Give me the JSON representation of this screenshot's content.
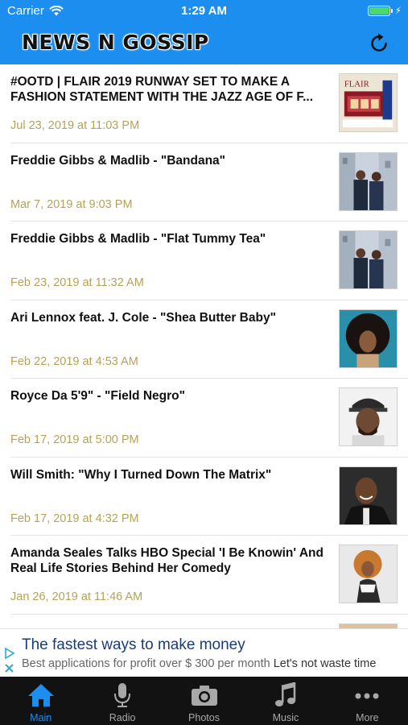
{
  "status_bar": {
    "carrier": "Carrier",
    "time": "1:29 AM",
    "battery_level": 1.0
  },
  "header": {
    "title": "NEWS N GOSSIP",
    "refresh_icon": "refresh-icon"
  },
  "articles": [
    {
      "title": "#OOTD | FLAIR 2019 RUNWAY SET TO MAKE A FASHION STATEMENT WITH THE JAZZ AGE OF F...",
      "date": "Jul 23, 2019 at 11:03 PM",
      "thumb_text": "FLAIR"
    },
    {
      "title": "Freddie Gibbs & Madlib - \"Bandana\"",
      "date": "Mar 7, 2019 at 9:03 PM"
    },
    {
      "title": "Freddie Gibbs & Madlib - \"Flat Tummy Tea\"",
      "date": "Feb 23, 2019 at 11:32 AM"
    },
    {
      "title": "Ari Lennox feat. J. Cole - \"Shea Butter Baby\"",
      "date": "Feb 22, 2019 at 4:53 AM"
    },
    {
      "title": "Royce Da 5'9\" - \"Field Negro\"",
      "date": "Feb 17, 2019 at 5:00 PM"
    },
    {
      "title": "Will Smith: \"Why I Turned Down The Matrix\"",
      "date": "Feb 17, 2019 at 4:32 PM"
    },
    {
      "title": "Amanda Seales Talks HBO Special 'I Be Knowin' And Real Life Stories Behind Her Comedy",
      "date": "Jan 26, 2019 at 11:46 AM"
    }
  ],
  "ad": {
    "headline": "The fastest ways to make money",
    "body": "Best applications for profit over $ 300 per month",
    "body_suffix": "Let's not waste time"
  },
  "tabs": [
    {
      "label": "Main",
      "icon": "home-icon",
      "active": true
    },
    {
      "label": "Radio",
      "icon": "microphone-icon",
      "active": false
    },
    {
      "label": "Photos",
      "icon": "camera-icon",
      "active": false
    },
    {
      "label": "Music",
      "icon": "music-note-icon",
      "active": false
    },
    {
      "label": "More",
      "icon": "more-dots-icon",
      "active": false
    }
  ],
  "colors": {
    "accent": "#1b8ef0",
    "date": "#b4a356",
    "tabbar": "#121212",
    "battery": "#4cd964"
  }
}
